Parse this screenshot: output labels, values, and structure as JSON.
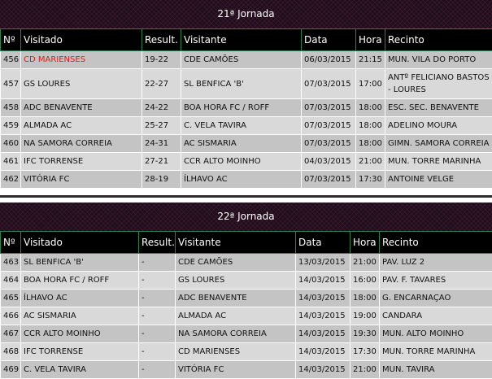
{
  "headers": [
    "Nº",
    "Visitado",
    "Result.",
    "Visitante",
    "Data",
    "Hora",
    "Recinto"
  ],
  "jornadas": [
    {
      "title": "21ª Jornada",
      "rows": [
        {
          "n": "456",
          "visitado": "CD MARIENSES",
          "result": "19-22",
          "visitante": "CDE CAMÕES",
          "data": "06/03/2015",
          "hora": "21:15",
          "recinto": "MUN. VILA DO PORTO",
          "highlight": true
        },
        {
          "n": "457",
          "visitado": "GS LOURES",
          "result": "22-27",
          "visitante": "SL BENFICA 'B'",
          "data": "07/03/2015",
          "hora": "17:00",
          "recinto": "ANTº FELICIANO BASTOS - LOURES"
        },
        {
          "n": "458",
          "visitado": "ADC BENAVENTE",
          "result": "24-22",
          "visitante": "BOA HORA FC / ROFF",
          "data": "07/03/2015",
          "hora": "18:00",
          "recinto": "ESC. SEC. BENAVENTE"
        },
        {
          "n": "459",
          "visitado": "ALMADA AC",
          "result": "25-27",
          "visitante": "C. VELA TAVIRA",
          "data": "07/03/2015",
          "hora": "18:00",
          "recinto": "ADELINO MOURA"
        },
        {
          "n": "460",
          "visitado": "NA SAMORA CORREIA",
          "result": "24-31",
          "visitante": "AC SISMARIA",
          "data": "07/03/2015",
          "hora": "18:00",
          "recinto": "GIMN. SAMORA CORREIA"
        },
        {
          "n": "461",
          "visitado": "IFC TORRENSE",
          "result": "27-21",
          "visitante": "CCR ALTO MOINHO",
          "data": "04/03/2015",
          "hora": "21:00",
          "recinto": "MUN. TORRE MARINHA"
        },
        {
          "n": "462",
          "visitado": "VITÓRIA FC",
          "result": "28-19",
          "visitante": "ÍLHAVO AC",
          "data": "07/03/2015",
          "hora": "17:30",
          "recinto": "ANTOINE VELGE"
        }
      ]
    },
    {
      "title": "22ª Jornada",
      "rows": [
        {
          "n": "463",
          "visitado": "SL BENFICA 'B'",
          "result": "-",
          "visitante": "CDE CAMÕES",
          "data": "13/03/2015",
          "hora": "21:00",
          "recinto": "PAV. LUZ 2"
        },
        {
          "n": "464",
          "visitado": "BOA HORA FC / ROFF",
          "result": "-",
          "visitante": "GS LOURES",
          "data": "14/03/2015",
          "hora": "16:00",
          "recinto": "PAV. F. TAVARES"
        },
        {
          "n": "465",
          "visitado": "ÍLHAVO AC",
          "result": "-",
          "visitante": "ADC BENAVENTE",
          "data": "14/03/2015",
          "hora": "18:00",
          "recinto": "G. ENCARNAÇAO"
        },
        {
          "n": "466",
          "visitado": "AC SISMARIA",
          "result": "-",
          "visitante": "ALMADA AC",
          "data": "14/03/2015",
          "hora": "19:00",
          "recinto": "CANDARA"
        },
        {
          "n": "467",
          "visitado": "CCR ALTO MOINHO",
          "result": "-",
          "visitante": "NA SAMORA CORREIA",
          "data": "14/03/2015",
          "hora": "19:30",
          "recinto": "MUN. ALTO MOINHO"
        },
        {
          "n": "468",
          "visitado": "IFC TORRENSE",
          "result": "-",
          "visitante": "CD MARIENSES",
          "data": "14/03/2015",
          "hora": "17:30",
          "recinto": "MUN. TORRE MARINHA"
        },
        {
          "n": "469",
          "visitado": "C. VELA TAVIRA",
          "result": "-",
          "visitante": "VITÓRIA FC",
          "data": "14/03/2015",
          "hora": "21:00",
          "recinto": "MUN. TAVIRA"
        }
      ]
    }
  ]
}
